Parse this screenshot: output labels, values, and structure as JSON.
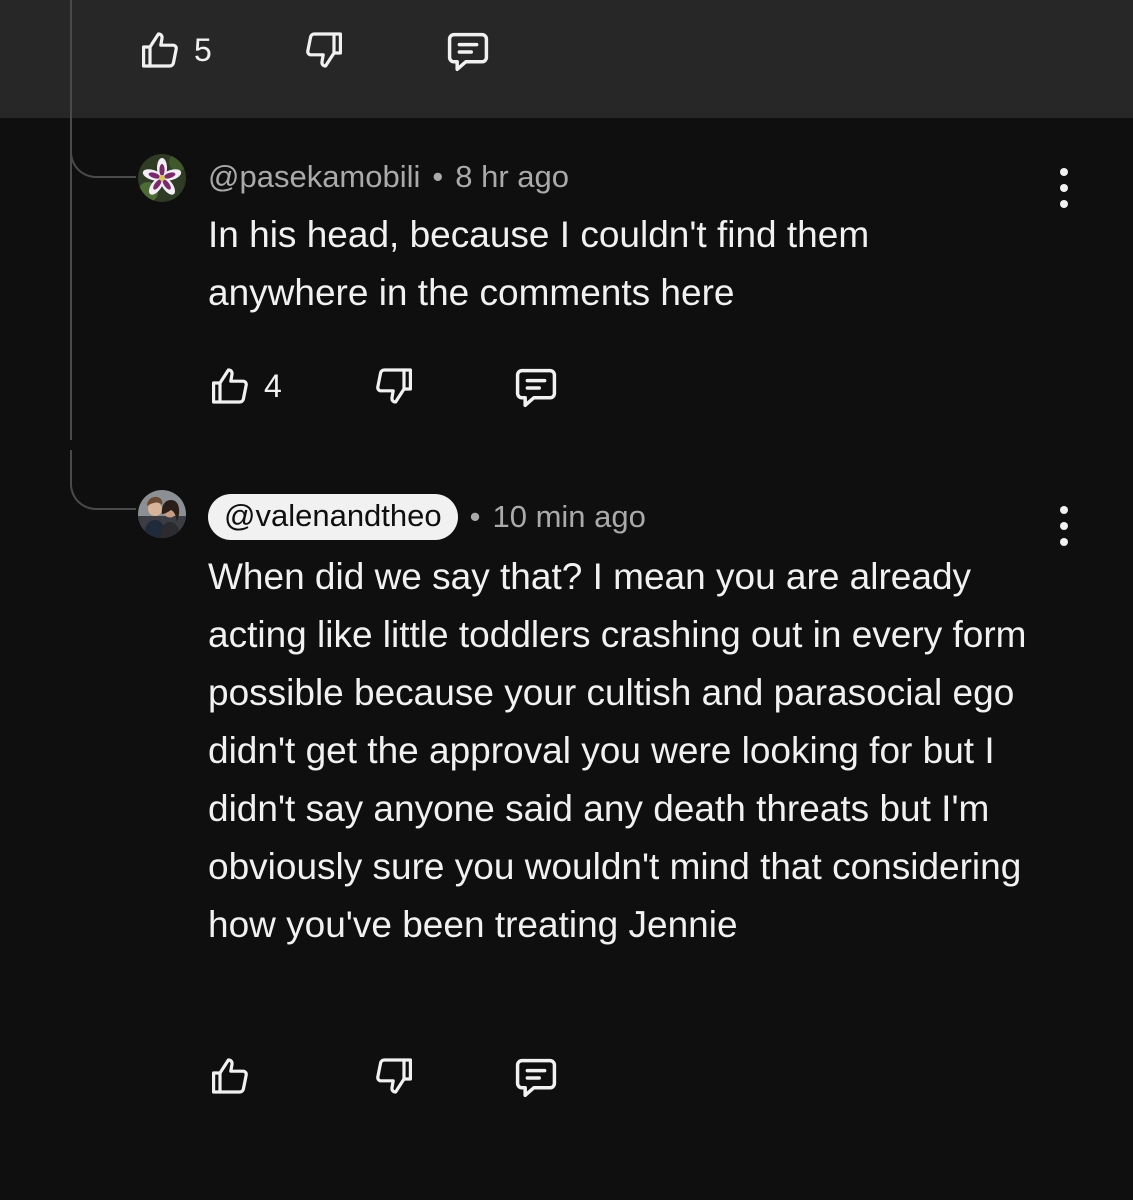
{
  "parent_comment": {
    "like_count": "5",
    "icons": [
      "thumbs-up-icon",
      "thumbs-down-icon",
      "reply-icon"
    ]
  },
  "replies": [
    {
      "handle": "@pasekamobili",
      "separator": "•",
      "time": "8 hr ago",
      "text": "In his head, because I couldn't find them anywhere in the comments here",
      "like_count": "4",
      "avatar": "flower-avatar"
    },
    {
      "handle": "@valenandtheo",
      "separator": "•",
      "time": "10 min ago",
      "text": "When did we say that? I mean you are already acting like little toddlers crashing out in every form possible because your cultish and parasocial ego didn't get the approval you were looking for but I didn't say anyone said any death threats but I'm obviously sure you wouldn't mind that considering how you've been treating Jennie",
      "like_count": "",
      "avatar": "couple-photo-avatar"
    }
  ],
  "colors": {
    "background": "#0f0f0f",
    "parent_band": "#272727",
    "text": "#f1f1f1",
    "meta_text": "#aaaaaa",
    "thread_line": "#4a4a4a",
    "handle_pill": "#f1f1f1"
  }
}
